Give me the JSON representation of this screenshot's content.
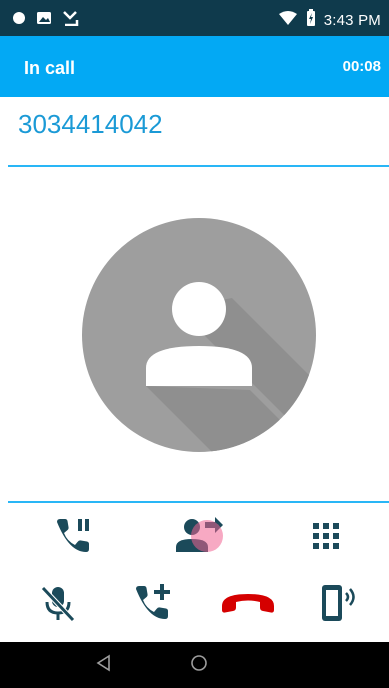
{
  "status_bar": {
    "time": "3:43 PM",
    "left_icons": [
      "notification-dot-icon",
      "image-icon",
      "missed-call-icon"
    ],
    "right_icons": [
      "wifi-icon",
      "battery-charging-icon"
    ]
  },
  "app_bar": {
    "title": "In call",
    "call_timer": "00:08"
  },
  "caller": {
    "number": "3034414042",
    "avatar": "default-person-avatar"
  },
  "controls": {
    "row1": [
      "hold-call-icon",
      "transfer-call-icon",
      "dialpad-icon"
    ],
    "row2": [
      "mute-mic-icon",
      "add-call-icon",
      "end-call-icon",
      "speaker-phone-icon"
    ]
  },
  "colors": {
    "status_bar": "#0f3a4c",
    "app_bar": "#03a9f4",
    "number_text": "#1b9ad6",
    "divider": "#29b6f6",
    "avatar_bg": "#9e9e9e",
    "end_call": "#d50000"
  }
}
